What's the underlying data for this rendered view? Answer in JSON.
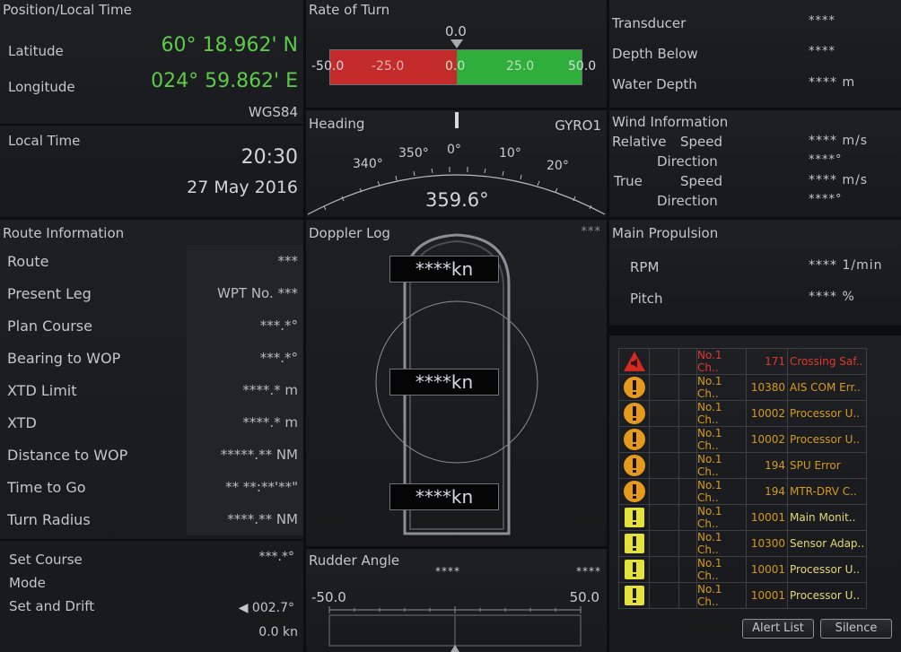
{
  "position": {
    "title": "Position/Local Time",
    "latitude_label": "Latitude",
    "latitude_value": "60° 18.962' N",
    "longitude_label": "Longitude",
    "longitude_value": "024° 59.862' E",
    "datum": "WGS84",
    "local_time_label": "Local Time",
    "local_time_value": "20:30",
    "date_value": "27 May 2016"
  },
  "rate_of_turn": {
    "title": "Rate of Turn",
    "value": "0.0",
    "scale": [
      "-50.0",
      "-25.0",
      "0.0",
      "25.0",
      "50.0"
    ],
    "colors": {
      "negative": "#c42c2c",
      "positive": "#2fae3c"
    }
  },
  "heading": {
    "title": "Heading",
    "source": "GYRO1",
    "value": "359.6°",
    "ticks": [
      "340°",
      "350°",
      "0°",
      "10°",
      "20°"
    ]
  },
  "depth": {
    "transducer_label": "Transducer",
    "transducer_value": "****",
    "depth_below_label": "Depth Below",
    "depth_below_value": "****",
    "water_depth_label": "Water Depth",
    "water_depth_value": "**** m"
  },
  "wind": {
    "title": "Wind Information",
    "relative_label": "Relative",
    "true_label": "True",
    "speed_label": "Speed",
    "direction_label": "Direction",
    "rel_speed_value": "**** m/s",
    "rel_dir_value": "****°",
    "true_speed_value": "**** m/s",
    "true_dir_value": "****°"
  },
  "route": {
    "title": "Route Information",
    "rows": [
      {
        "label": "Route",
        "value": "***"
      },
      {
        "label": "Present Leg",
        "value": "WPT No. ***"
      },
      {
        "label": "Plan Course",
        "value": "***.*°"
      },
      {
        "label": "Bearing to WOP",
        "value": "***.*°"
      },
      {
        "label": "XTD Limit",
        "value": "****.* m"
      },
      {
        "label": "XTD",
        "value": "****.* m"
      },
      {
        "label": "Distance to WOP",
        "value": "*****.** NM"
      },
      {
        "label": "Time to Go",
        "value": "** **:**'**\""
      },
      {
        "label": "Turn Radius",
        "value": "****.** NM"
      }
    ],
    "set_course_label": "Set Course",
    "set_course_value": "***.*°",
    "mode_label": "Mode",
    "set_drift_label": "Set and Drift",
    "set_value": "◀ 002.7°",
    "drift_value": "0.0 kn"
  },
  "doppler": {
    "title": "Doppler Log",
    "status": "***",
    "bow_speed": "****kn",
    "mid_speed": "****kn",
    "stern_speed": "****kn"
  },
  "propulsion": {
    "title": "Main Propulsion",
    "rpm_label": "RPM",
    "rpm_value": "**** 1/min",
    "pitch_label": "Pitch",
    "pitch_value": "**** %"
  },
  "rudder": {
    "title": "Rudder Angle",
    "value": "****",
    "value2": "****",
    "scale_left": "-50.0",
    "scale_right": "50.0"
  },
  "alerts": {
    "rows": [
      {
        "icon": "red-warning-icon",
        "source": "No.1 Ch..",
        "code": "171",
        "message": "Crossing Saf..",
        "severity": "alarm"
      },
      {
        "icon": "orange-warning-icon",
        "source": "No.1 Ch..",
        "code": "10380",
        "message": "AIS COM Err..",
        "severity": "warning"
      },
      {
        "icon": "orange-warning-icon",
        "source": "No.1 Ch..",
        "code": "10002",
        "message": "Processor U..",
        "severity": "warning"
      },
      {
        "icon": "orange-warning-icon",
        "source": "No.1 Ch..",
        "code": "10002",
        "message": "Processor U..",
        "severity": "warning"
      },
      {
        "icon": "orange-warning-icon",
        "source": "No.1 Ch..",
        "code": "194",
        "message": "SPU Error",
        "severity": "warning"
      },
      {
        "icon": "orange-warning-icon",
        "source": "No.1 Ch..",
        "code": "194",
        "message": "MTR-DRV C..",
        "severity": "warning"
      },
      {
        "icon": "yellow-caution-icon",
        "source": "No.1 Ch..",
        "code": "10001",
        "message": "Main Monit..",
        "severity": "caution"
      },
      {
        "icon": "yellow-caution-icon",
        "source": "No.1 Ch..",
        "code": "10300",
        "message": "Sensor Adap..",
        "severity": "caution"
      },
      {
        "icon": "yellow-caution-icon",
        "source": "No.1 Ch..",
        "code": "10001",
        "message": "Processor U..",
        "severity": "caution"
      },
      {
        "icon": "yellow-caution-icon",
        "source": "No.1 Ch..",
        "code": "10001",
        "message": "Processor U..",
        "severity": "caution"
      }
    ],
    "alert_list_label": "Alert List",
    "silence_label": "Silence"
  }
}
